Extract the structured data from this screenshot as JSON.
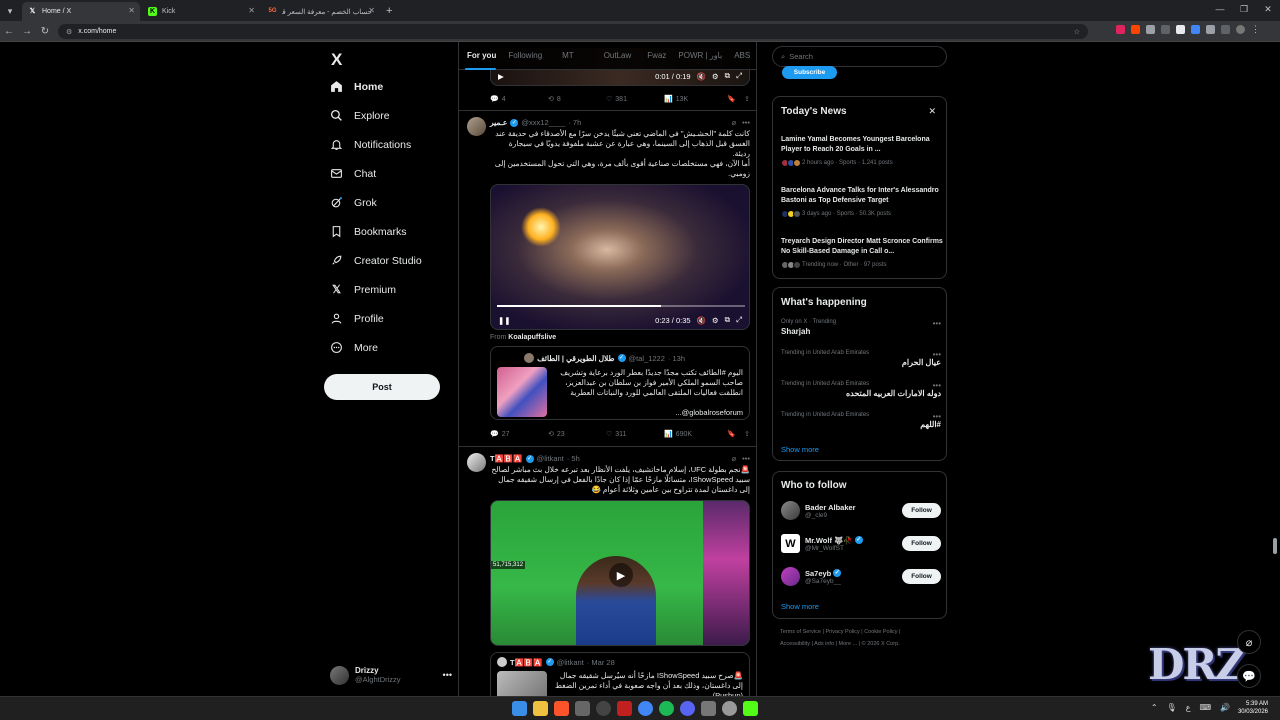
{
  "browser": {
    "tabs": [
      {
        "label": "Home / X",
        "icon": "x-logo-icon",
        "active": true
      },
      {
        "label": "Kick",
        "icon": "kick-icon",
        "active": false
      },
      {
        "label": "حساب الخصم - معرفة السعر قبل",
        "icon": "5g-icon",
        "active": false
      }
    ],
    "url": "x.com/home"
  },
  "nav": {
    "logo": "X",
    "items": [
      {
        "label": "Home",
        "icon": "home-icon"
      },
      {
        "label": "Explore",
        "icon": "search-icon"
      },
      {
        "label": "Notifications",
        "icon": "bell-icon"
      },
      {
        "label": "Chat",
        "icon": "mail-icon"
      },
      {
        "label": "Grok",
        "icon": "grok-icon"
      },
      {
        "label": "Bookmarks",
        "icon": "bookmark-icon"
      },
      {
        "label": "Creator Studio",
        "icon": "rocket-icon"
      },
      {
        "label": "Premium",
        "icon": "x-logo-icon"
      },
      {
        "label": "Profile",
        "icon": "user-icon"
      },
      {
        "label": "More",
        "icon": "more-circle-icon"
      }
    ],
    "post_label": "Post",
    "account": {
      "name": "Drizzy",
      "handle": "@AlghtDrizzy"
    }
  },
  "timeline": {
    "tabs": [
      "For you",
      "Following",
      "MT",
      "OutLaw",
      "Fwaz",
      "POWR | باور",
      "ABS"
    ],
    "tweets": [
      {
        "video_time": "0:01 / 0:19",
        "stats": {
          "replies": "4",
          "reposts": "8",
          "likes": "381",
          "views": "13K"
        }
      },
      {
        "name": "عـمير",
        "handle": "@xxx12____",
        "time": "· 7h",
        "text1": "كانت كلمة \"الحشـيش\" في الماضي تعني شيئًا يدخن سرًا مع الأصدقاء في حديقة عند الغسق قبل الذهاب إلى السينما، وهي عبارة عن عشبة ملفوفة يدويًا في سيجارة رديئة.",
        "text2": "أما الآن، فهي مستخلصات صناعية أقوى بألف مرة، وهي التي تحول المستخدمين إلى زومبي.",
        "video_time": "0:23 / 0:35",
        "video_progress": 0.66,
        "from_label": "From",
        "from_source": "Koalapuffslive",
        "quote": {
          "name": "طلال الطويرقي | الطائف",
          "handle": "@tal_1222",
          "time": "· 13h",
          "text": "اليوم #الطائف تكتب مجدًا جديدًا بعطر الورد برعاية وتشريف صاحب السمو الملكي الأمير فواز بن سلطان بن عبدالعزيز، انطلقت فعاليات الملتقى العالمي للورد والنباتات العطرية",
          "mention": "...@globalroseforum"
        },
        "stats": {
          "replies": "27",
          "reposts": "23",
          "likes": "311",
          "views": "690K"
        }
      },
      {
        "name": "T🅰️🅱️🅰️",
        "handle": "@litkant",
        "time": "· 5h",
        "text": "🚨نجم بطولة UFC، إسلام ماخاتشيف، يلفت الأنظار بعد تبرعه خلال بث مباشر لصالح سبيد IShowSpeed، متسائلًا مازحًا عمّا إذا كان جادًا بالفعل في إرسال شقيقه جمال إلى داغستان لمدة تتراوح بين عامين وثلاثة أعوام 😂",
        "overlay_count": "51,715,312",
        "quote": {
          "name": "T🅰️🅱️🅰️",
          "handle": "@litkant",
          "time": "· Mar 28",
          "text": "🚨صرح سبيد IShowSpeed مازحًا أنه سيُرسل شقيقه جمال إلى داغستان، وذلك بعد أن واجه صعوبة في أداء تمرين الضغط (Pushup)"
        }
      }
    ]
  },
  "sidebar": {
    "search_placeholder": "Search",
    "subscribe_label": "Subscribe",
    "news": {
      "title": "Today's News",
      "items": [
        {
          "headline": "Lamine Yamal Becomes Youngest Barcelona Player to Reach 20 Goals in ...",
          "meta": "2 hours ago · Sports · 1,241 posts"
        },
        {
          "headline": "Barcelona Advance Talks for Inter's Alessandro Bastoni as Top Defensive Target",
          "meta": "3 days ago · Sports · 50.3K posts"
        },
        {
          "headline": "Treyarch Design Director Matt Scronce Confirms No Skill-Based Damage in Call o...",
          "meta": "Trending now · Other · 97 posts"
        }
      ]
    },
    "happening": {
      "title": "What's happening",
      "trends": [
        {
          "context": "Only on X · Trending",
          "topic": "Sharjah",
          "rtl": false
        },
        {
          "context": "Trending in United Arab Emirates",
          "topic": "عيال الحرام",
          "rtl": true
        },
        {
          "context": "Trending in United Arab Emirates",
          "topic": "دوله الامارات العربيه المتحده",
          "rtl": true
        },
        {
          "context": "Trending in United Arab Emirates",
          "topic": "#اللهم",
          "rtl": true
        }
      ],
      "show_more": "Show more"
    },
    "who_to_follow": {
      "title": "Who to follow",
      "accounts": [
        {
          "name": "Bader Albaker",
          "handle": "@_cle9",
          "verified": false
        },
        {
          "name": "Mr.Wolf 🐺🥀",
          "handle": "@Mr_WolfST",
          "verified": true
        },
        {
          "name": "Sa7eyb",
          "handle": "@Sa7eyb__",
          "verified": true
        }
      ],
      "follow_label": "Follow",
      "show_more": "Show more"
    },
    "footer": {
      "line1": [
        "Terms of Service",
        "Privacy Policy",
        "Cookie Policy"
      ],
      "line2": [
        "Accessibility",
        "Ads info",
        "More ...",
        "© 2026 X Corp."
      ]
    }
  },
  "overlay": {
    "watermark": "DRZ"
  },
  "taskbar": {
    "time": "5:39 AM",
    "date": "30/03/2026",
    "lang": "ع"
  },
  "colors": {
    "accent": "#1d9bf0",
    "bg": "#000000",
    "border": "#2f3336",
    "muted": "#71767b"
  }
}
